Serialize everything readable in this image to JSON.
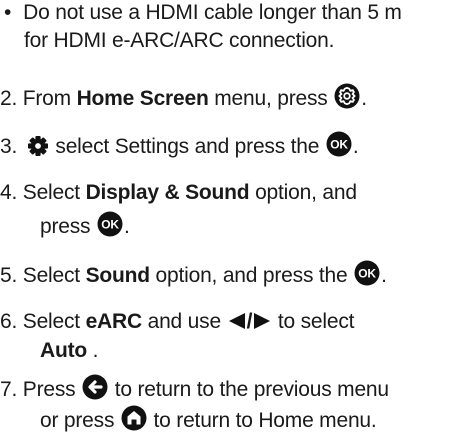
{
  "bullet": {
    "marker": "•",
    "text1": "Do not use a HDMI cable longer than 5 m",
    "text2": "for HDMI e-ARC/ARC connection."
  },
  "steps": {
    "s2": {
      "num": "2.",
      "pre": "From ",
      "bold": "Home Screen",
      "post": " menu, press ",
      "end": "."
    },
    "s3": {
      "num": "3.",
      "text": " select Settings and press the ",
      "end": "."
    },
    "s4": {
      "num": "4.",
      "pre": "Select ",
      "bold": "Display & Sound",
      "post": " option, and",
      "line2": "press ",
      "end": "."
    },
    "s5": {
      "num": "5.",
      "pre": "Select ",
      "bold": "Sound",
      "post": " option, and press the ",
      "end": "."
    },
    "s6": {
      "num": "6.",
      "pre": "Select ",
      "bold": "eARC",
      "mid": " and use ",
      "slash": "/",
      "post": " to select",
      "line2_bold": "Auto",
      "line2_end": " ."
    },
    "s7": {
      "num": "7.",
      "pre": "Press ",
      "post": " to return to the previous menu",
      "line2_pre": "or press ",
      "line2_post": " to return to Home menu."
    }
  },
  "icons": {
    "settings_button": "settings-gear-circle-icon",
    "settings_gear": "gear-icon",
    "ok_button": "ok-button-icon",
    "ok_label": "OK",
    "left_arrow": "left-triangle-icon",
    "right_arrow": "right-triangle-icon",
    "back_button": "back-arrow-circle-icon",
    "home_button": "home-circle-icon"
  },
  "colors": {
    "text": "#1a1a1a",
    "icon": "#111111"
  }
}
